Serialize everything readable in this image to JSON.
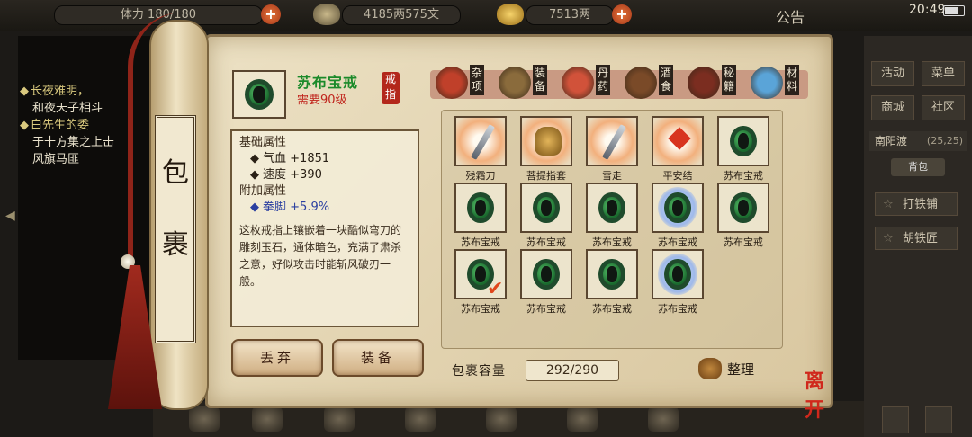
{
  "topbar": {
    "stamina": "体力 180/180",
    "money": "4185两575文",
    "gold": "7513两",
    "notice": "公告",
    "time": "20:49"
  },
  "quest": {
    "lines": [
      {
        "text": "长夜难明，",
        "head": true
      },
      {
        "text": "和夜天子相斗",
        "head": false
      },
      {
        "text": "白先生的委",
        "head": true
      },
      {
        "text": "于十方集之上击",
        "head": false
      },
      {
        "text": "风旗马匪",
        "head": false
      }
    ]
  },
  "right_menu": {
    "activity": "活动",
    "menu": "菜单",
    "shop": "商城",
    "community": "社区",
    "location": "南阳渡",
    "coords": "(25,25)",
    "bag_tab": "背包",
    "npc1": "打铁铺",
    "npc2": "胡铁匠"
  },
  "scroll": {
    "c1": "包",
    "c2": "裹"
  },
  "selected": {
    "name": "苏布宝戒",
    "requirement": "需要90级",
    "tag": "戒指",
    "base_title": "基础属性",
    "base": [
      {
        "label": "气血",
        "value": "+1851"
      },
      {
        "label": "速度",
        "value": "+390"
      }
    ],
    "extra_title": "附加属性",
    "extra": [
      {
        "label": "拳脚",
        "value": "+5.9%"
      }
    ],
    "description": "这枚戒指上镶嵌着一块酷似弯刀的雕刻玉石，通体暗色，充满了肃杀之意，好似攻击时能斩风破刃一般。"
  },
  "buttons": {
    "discard": "丢弃",
    "equip": "装备"
  },
  "tabs": [
    {
      "label": "杂项",
      "icon": "jar-icon",
      "color": "#c0402a"
    },
    {
      "label": "装备",
      "icon": "weapon-icon",
      "color": "#8a6b3c"
    },
    {
      "label": "丹药",
      "icon": "pill-icon",
      "color": "#d1523a"
    },
    {
      "label": "酒食",
      "icon": "wine-icon",
      "color": "#7a4a28"
    },
    {
      "label": "秘籍",
      "icon": "book-icon",
      "color": "#7b2d20"
    },
    {
      "label": "材料",
      "icon": "crystal-icon",
      "color": "#5aa4d8"
    }
  ],
  "items": [
    {
      "name": "残霜刀",
      "kind": "knife",
      "hl": true
    },
    {
      "name": "菩提指套",
      "kind": "glove",
      "hl": true
    },
    {
      "name": "雪走",
      "kind": "knife",
      "hl": true
    },
    {
      "name": "平安结",
      "kind": "knot",
      "hl": true
    },
    {
      "name": "苏布宝戒",
      "kind": "ring-green"
    },
    {
      "name": "苏布宝戒",
      "kind": "ring-green"
    },
    {
      "name": "苏布宝戒",
      "kind": "ring-green"
    },
    {
      "name": "苏布宝戒",
      "kind": "ring-green"
    },
    {
      "name": "苏布宝戒",
      "kind": "ring-blue"
    },
    {
      "name": "苏布宝戒",
      "kind": "ring-green"
    },
    {
      "name": "苏布宝戒",
      "kind": "ring-green",
      "checked": true
    },
    {
      "name": "苏布宝戒",
      "kind": "ring-green"
    },
    {
      "name": "苏布宝戒",
      "kind": "ring-green"
    },
    {
      "name": "苏布宝戒",
      "kind": "ring-blue"
    }
  ],
  "capacity": {
    "label": "包裹容量",
    "value": "292/290"
  },
  "sort_label": "整理",
  "leave_label": "离开"
}
